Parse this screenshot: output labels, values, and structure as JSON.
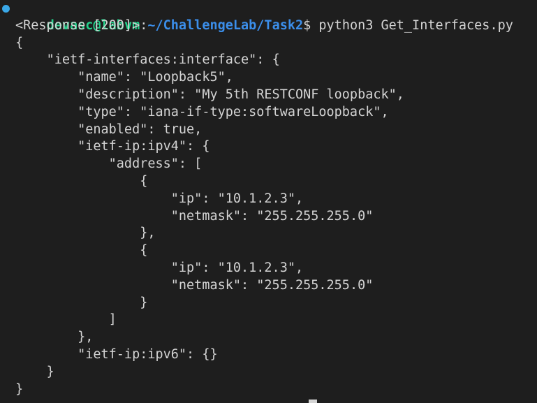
{
  "prompt": {
    "user_host": "devasc@labvm",
    "separator": ":",
    "path": "~/ChallengeLab/Task2",
    "dollar": "$ ",
    "command": "python3 Get_Interfaces.py"
  },
  "output_lines": [
    {
      "indent": 0,
      "text": "<Response [200]>"
    },
    {
      "indent": 0,
      "text": "{"
    },
    {
      "indent": 4,
      "text": "\"ietf-interfaces:interface\": {"
    },
    {
      "indent": 8,
      "text": "\"name\": \"Loopback5\","
    },
    {
      "indent": 8,
      "text": "\"description\": \"My 5th RESTCONF loopback\","
    },
    {
      "indent": 8,
      "text": "\"type\": \"iana-if-type:softwareLoopback\","
    },
    {
      "indent": 8,
      "text": "\"enabled\": true,"
    },
    {
      "indent": 8,
      "text": "\"ietf-ip:ipv4\": {"
    },
    {
      "indent": 12,
      "text": "\"address\": ["
    },
    {
      "indent": 16,
      "text": "{"
    },
    {
      "indent": 20,
      "text": "\"ip\": \"10.1.2.3\","
    },
    {
      "indent": 20,
      "text": "\"netmask\": \"255.255.255.0\""
    },
    {
      "indent": 16,
      "text": "},"
    },
    {
      "indent": 16,
      "text": "{"
    },
    {
      "indent": 20,
      "text": "\"ip\": \"10.1.2.3\","
    },
    {
      "indent": 20,
      "text": "\"netmask\": \"255.255.255.0\""
    },
    {
      "indent": 16,
      "text": "}"
    },
    {
      "indent": 12,
      "text": "]"
    },
    {
      "indent": 8,
      "text": "},"
    },
    {
      "indent": 8,
      "text": "\"ietf-ip:ipv6\": {}"
    },
    {
      "indent": 4,
      "text": "}"
    },
    {
      "indent": 0,
      "text": "}"
    }
  ],
  "colors": {
    "background": "#1e1e1e",
    "foreground": "#d4d4d4",
    "user_host": "#23d18b",
    "path": "#3b8eea",
    "marker": "#3aa8e8"
  },
  "icons": {
    "prompt_marker": "command-status-dot-icon",
    "cursor": "terminal-cursor-icon"
  }
}
